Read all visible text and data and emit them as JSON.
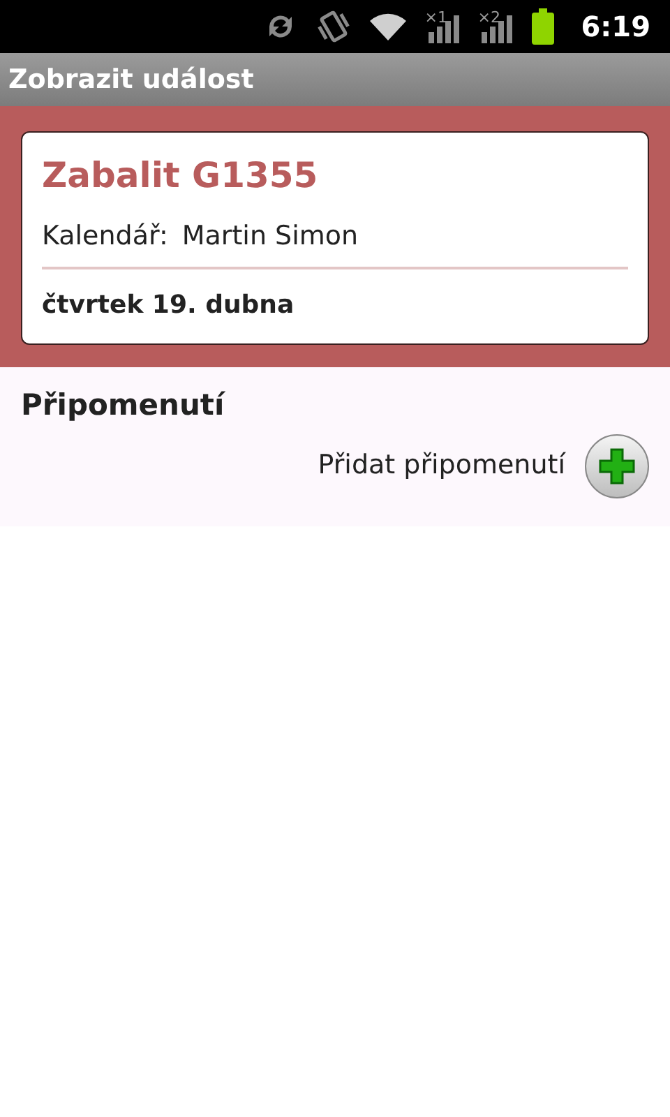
{
  "status_bar": {
    "signals": [
      {
        "label": "×1"
      },
      {
        "label": "×2"
      }
    ],
    "time": "6:19"
  },
  "title_bar": {
    "title": "Zobrazit událost"
  },
  "event": {
    "color": "#b85c5c",
    "title": "Zabalit G1355",
    "calendar_label": "Kalendář:",
    "calendar_name": "Martin Simon",
    "date": "čtvrtek 19. dubna"
  },
  "reminders": {
    "heading": "Připomenutí",
    "add_label": "Přidat připomenutí"
  }
}
